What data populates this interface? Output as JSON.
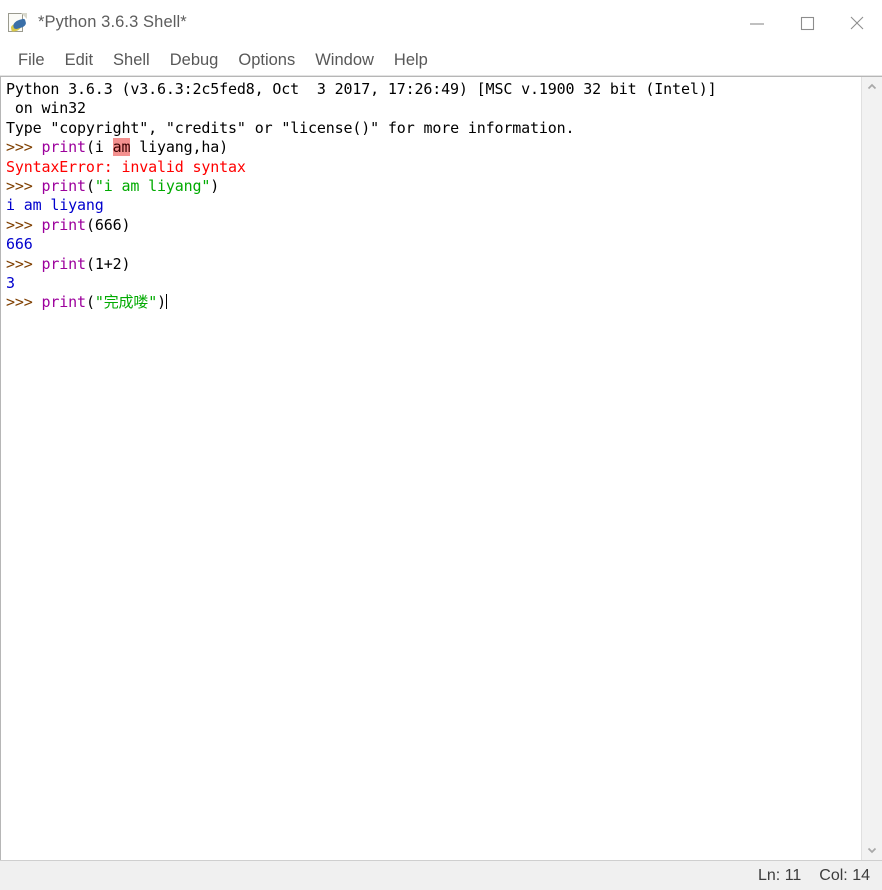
{
  "window": {
    "title": "*Python 3.6.3 Shell*",
    "icon": "python-idle-icon",
    "controls": {
      "minimize": "minimize-button",
      "maximize": "maximize-button",
      "close": "close-button"
    }
  },
  "menubar": {
    "items": [
      {
        "label": "File"
      },
      {
        "label": "Edit"
      },
      {
        "label": "Shell"
      },
      {
        "label": "Debug"
      },
      {
        "label": "Options"
      },
      {
        "label": "Window"
      },
      {
        "label": "Help"
      }
    ]
  },
  "console": {
    "lines": [
      {
        "segments": [
          {
            "text": "Python 3.6.3 (v3.6.3:2c5fed8, Oct  3 2017, 17:26:49) [MSC v.1900 32 bit (Intel)]",
            "style": "plain"
          }
        ]
      },
      {
        "segments": [
          {
            "text": " on win32",
            "style": "plain"
          }
        ]
      },
      {
        "segments": [
          {
            "text": "Type ",
            "style": "plain"
          },
          {
            "text": "\"copyright\"",
            "style": "plain"
          },
          {
            "text": ", ",
            "style": "plain"
          },
          {
            "text": "\"credits\"",
            "style": "plain"
          },
          {
            "text": " or ",
            "style": "plain"
          },
          {
            "text": "\"license()\"",
            "style": "plain"
          },
          {
            "text": " for more information.",
            "style": "plain"
          }
        ]
      },
      {
        "segments": [
          {
            "text": ">>> ",
            "style": "prompt"
          },
          {
            "text": "print",
            "style": "kw"
          },
          {
            "text": "(i ",
            "style": "plain"
          },
          {
            "text": "am",
            "style": "hl"
          },
          {
            "text": " liyang,ha)",
            "style": "plain"
          }
        ]
      },
      {
        "segments": [
          {
            "text": "SyntaxError: invalid syntax",
            "style": "err"
          }
        ]
      },
      {
        "segments": [
          {
            "text": ">>> ",
            "style": "prompt"
          },
          {
            "text": "print",
            "style": "kw"
          },
          {
            "text": "(",
            "style": "plain"
          },
          {
            "text": "\"i am liyang\"",
            "style": "str"
          },
          {
            "text": ")",
            "style": "plain"
          }
        ]
      },
      {
        "segments": [
          {
            "text": "i am liyang",
            "style": "out"
          }
        ]
      },
      {
        "segments": [
          {
            "text": ">>> ",
            "style": "prompt"
          },
          {
            "text": "print",
            "style": "kw"
          },
          {
            "text": "(666)",
            "style": "plain"
          }
        ]
      },
      {
        "segments": [
          {
            "text": "666",
            "style": "out"
          }
        ]
      },
      {
        "segments": [
          {
            "text": ">>> ",
            "style": "prompt"
          },
          {
            "text": "print",
            "style": "kw"
          },
          {
            "text": "(1+2)",
            "style": "plain"
          }
        ]
      },
      {
        "segments": [
          {
            "text": "3",
            "style": "out"
          }
        ]
      },
      {
        "segments": [
          {
            "text": ">>> ",
            "style": "prompt"
          },
          {
            "text": "print",
            "style": "kw"
          },
          {
            "text": "(",
            "style": "plain"
          },
          {
            "text": "\"完成喽\"",
            "style": "str"
          },
          {
            "text": ")",
            "style": "plain"
          }
        ]
      }
    ],
    "scrollbar": {
      "up_arrow": "scroll-up-arrow-icon",
      "down_arrow": "scroll-down-arrow-icon"
    }
  },
  "statusbar": {
    "line_label": "Ln: 11",
    "col_label": "Col: 14"
  },
  "colors": {
    "prompt": "#7f3f00",
    "keyword": "#9c009c",
    "string": "#00aa00",
    "error": "#ff0000",
    "output": "#0000cd",
    "highlight_bg": "#f4918f",
    "window_bg": "#ffffff",
    "statusbar_bg": "#f0f0f0"
  }
}
